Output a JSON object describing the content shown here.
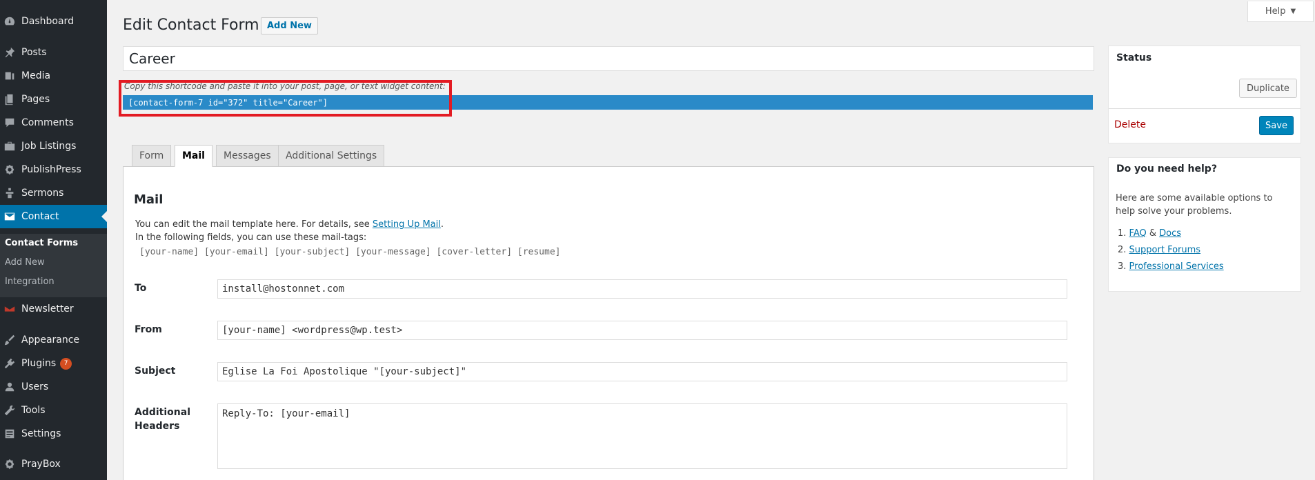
{
  "sidebar": {
    "items": [
      {
        "label": "Dashboard",
        "icon": "dashboard-icon"
      },
      {
        "label": "Posts",
        "icon": "pin-icon"
      },
      {
        "label": "Media",
        "icon": "media-icon"
      },
      {
        "label": "Pages",
        "icon": "pages-icon"
      },
      {
        "label": "Comments",
        "icon": "comment-icon"
      },
      {
        "label": "Job Listings",
        "icon": "briefcase-icon"
      },
      {
        "label": "PublishPress",
        "icon": "gear-icon"
      },
      {
        "label": "Sermons",
        "icon": "podium-icon"
      },
      {
        "label": "Contact",
        "icon": "envelope-icon"
      },
      {
        "label": "Newsletter",
        "icon": "newsletter-icon"
      },
      {
        "label": "Appearance",
        "icon": "brush-icon"
      },
      {
        "label": "Plugins",
        "icon": "plugin-icon",
        "badge": "7"
      },
      {
        "label": "Users",
        "icon": "user-icon"
      },
      {
        "label": "Tools",
        "icon": "wrench-icon"
      },
      {
        "label": "Settings",
        "icon": "settings-icon"
      },
      {
        "label": "PrayBox",
        "icon": "gear-icon"
      }
    ],
    "submenu": [
      "Contact Forms",
      "Add New",
      "Integration"
    ],
    "colors": {
      "bg": "#23282d",
      "active": "#0073aa"
    }
  },
  "header": {
    "help_label": "Help",
    "title": "Edit Contact Form",
    "add_new": "Add New"
  },
  "form": {
    "title_value": "Career",
    "shortcode_hint": "Copy this shortcode and paste it into your post, page, or text widget content:",
    "shortcode": "[contact-form-7 id=\"372\" title=\"Career\"]"
  },
  "tabs": [
    "Form",
    "Mail",
    "Messages",
    "Additional Settings"
  ],
  "mail": {
    "heading": "Mail",
    "desc_prefix": "You can edit the mail template here. For details, see ",
    "desc_link": "Setting Up Mail",
    "desc_suffix": ".",
    "desc_line2": "In the following fields, you can use these mail-tags:",
    "mail_tags": "[your-name] [your-email] [your-subject] [your-message] [cover-letter] [resume]",
    "fields": {
      "to_label": "To",
      "to_value": "install@hostonnet.com",
      "from_label": "From",
      "from_value": "[your-name] <wordpress@wp.test>",
      "subject_label": "Subject",
      "subject_value": "Eglise La Foi Apostolique \"[your-subject]\"",
      "headers_label_1": "Additional",
      "headers_label_2": "Headers",
      "headers_value": "Reply-To: [your-email]"
    }
  },
  "status_box": {
    "title": "Status",
    "duplicate": "Duplicate",
    "delete": "Delete",
    "save": "Save"
  },
  "help_box": {
    "title": "Do you need help?",
    "text": "Here are some available options to help solve your problems.",
    "items": [
      {
        "num": "1.",
        "link1": "FAQ",
        "sep": " & ",
        "link2": "Docs"
      },
      {
        "num": "2.",
        "link1": "Support Forums"
      },
      {
        "num": "3.",
        "link1": "Professional Services"
      }
    ]
  }
}
